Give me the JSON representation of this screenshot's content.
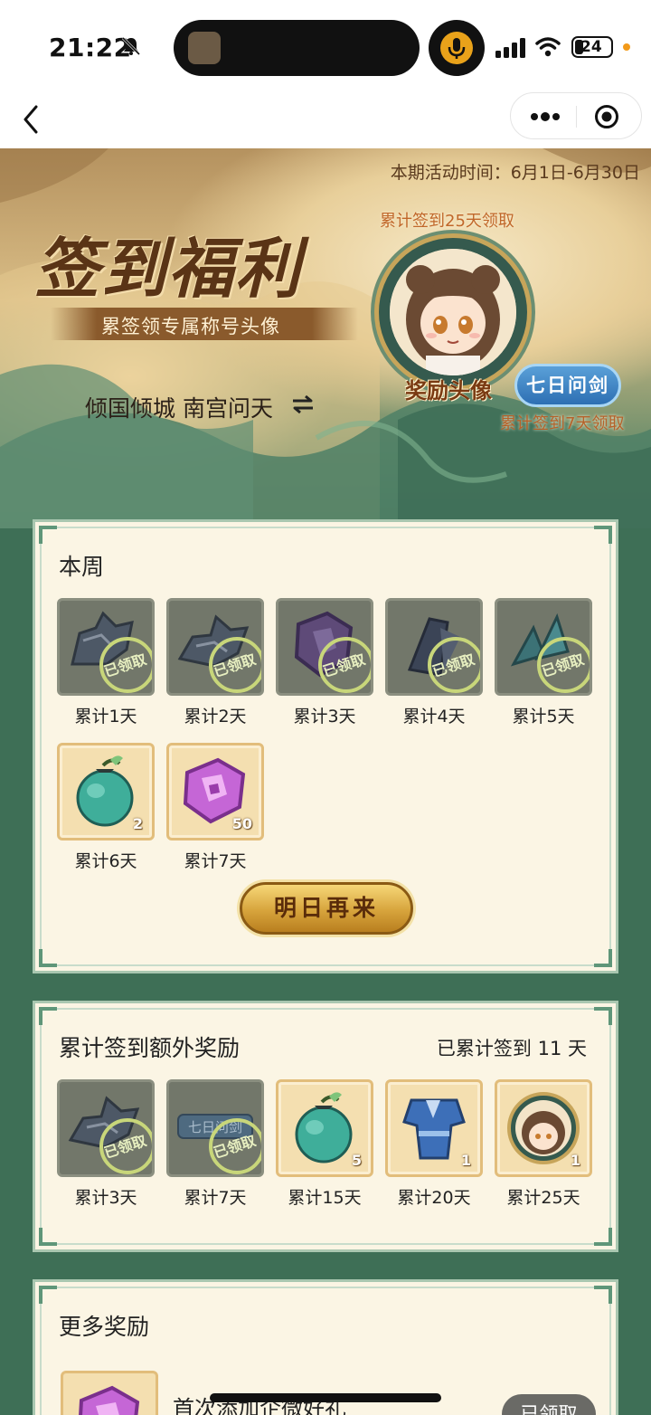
{
  "status_bar": {
    "time": "21:22",
    "battery": "24",
    "icons": [
      "bell-off-icon",
      "app-icon",
      "mic-icon",
      "signal-icon",
      "wifi-icon",
      "battery-icon"
    ]
  },
  "nav": {
    "back_icon": "chevron-left-icon",
    "more_icon": "more-dots-icon",
    "close_icon": "target-circle-icon"
  },
  "banner": {
    "period": "本期活动时间：6月1日-6月30日",
    "title": "签到福利",
    "subtitle": "累签领专属称号头像",
    "player_name": "倾国倾城 南宫问天",
    "avatar_caption_top": "累计签到25天领取",
    "avatar_label": "奖励头像",
    "title_badge": "七日问剑",
    "title_badge_caption": "累计签到7天领取"
  },
  "week": {
    "title": "本周",
    "claimed_stamp": "已领取",
    "items": [
      {
        "label": "累计1天",
        "claimed": true,
        "icon": "broken-gear-icon"
      },
      {
        "label": "累计2天",
        "claimed": true,
        "icon": "broken-gear-icon"
      },
      {
        "label": "累计3天",
        "claimed": true,
        "icon": "purple-seal-icon"
      },
      {
        "label": "累计4天",
        "claimed": true,
        "icon": "dark-crystal-icon"
      },
      {
        "label": "累计5天",
        "claimed": true,
        "icon": "teal-crystal-icon"
      },
      {
        "label": "累计6天",
        "claimed": false,
        "icon": "green-pouch-icon",
        "qty": "2"
      },
      {
        "label": "累计7天",
        "claimed": false,
        "icon": "purple-seal-icon",
        "qty": "50"
      }
    ],
    "button": "明日再来"
  },
  "cumulative": {
    "title": "累计签到额外奖励",
    "progress_text": "已累计签到 11 天",
    "claimed_stamp": "已领取",
    "items": [
      {
        "label": "累计3天",
        "claimed": true,
        "icon": "broken-gear-icon"
      },
      {
        "label": "累计7天",
        "claimed": true,
        "icon": "title-plate-icon",
        "plate": "七日问剑"
      },
      {
        "label": "累计15天",
        "claimed": false,
        "icon": "green-pouch-icon",
        "qty": "5"
      },
      {
        "label": "累计20天",
        "claimed": false,
        "icon": "blue-outfit-icon",
        "qty": "1"
      },
      {
        "label": "累计25天",
        "claimed": false,
        "icon": "avatar-frame-icon",
        "qty": "1"
      }
    ]
  },
  "more": {
    "title": "更多奖励",
    "item_name": "首次添加企微好礼",
    "button": "已领取"
  },
  "colors": {
    "panel_bg": "#fbf5e4",
    "panel_border": "#a9c7b0",
    "page_bg": "#3e6f56",
    "gold_button": "#d7a43c",
    "badge_blue": "#2d6fb3"
  }
}
